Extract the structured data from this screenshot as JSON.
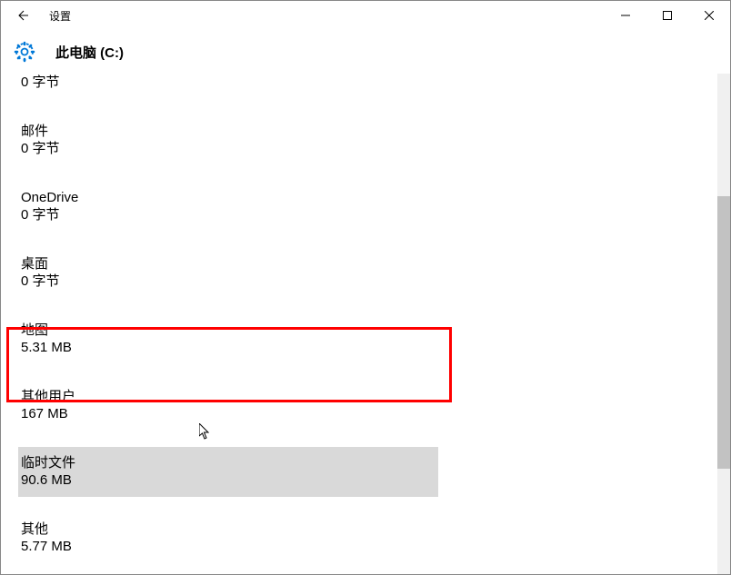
{
  "titlebar": {
    "title": "设置"
  },
  "header": {
    "page_title": "此电脑 (C:)"
  },
  "storage_items": [
    {
      "name": "",
      "size": "0 字节"
    },
    {
      "name": "邮件",
      "size": "0 字节"
    },
    {
      "name": "OneDrive",
      "size": "0 字节"
    },
    {
      "name": "桌面",
      "size": "0 字节"
    },
    {
      "name": "地图",
      "size": "5.31 MB"
    },
    {
      "name": "其他用户",
      "size": "167 MB"
    },
    {
      "name": "临时文件",
      "size": "90.6 MB",
      "selected": true
    },
    {
      "name": "其他",
      "size": "5.77 MB"
    }
  ]
}
